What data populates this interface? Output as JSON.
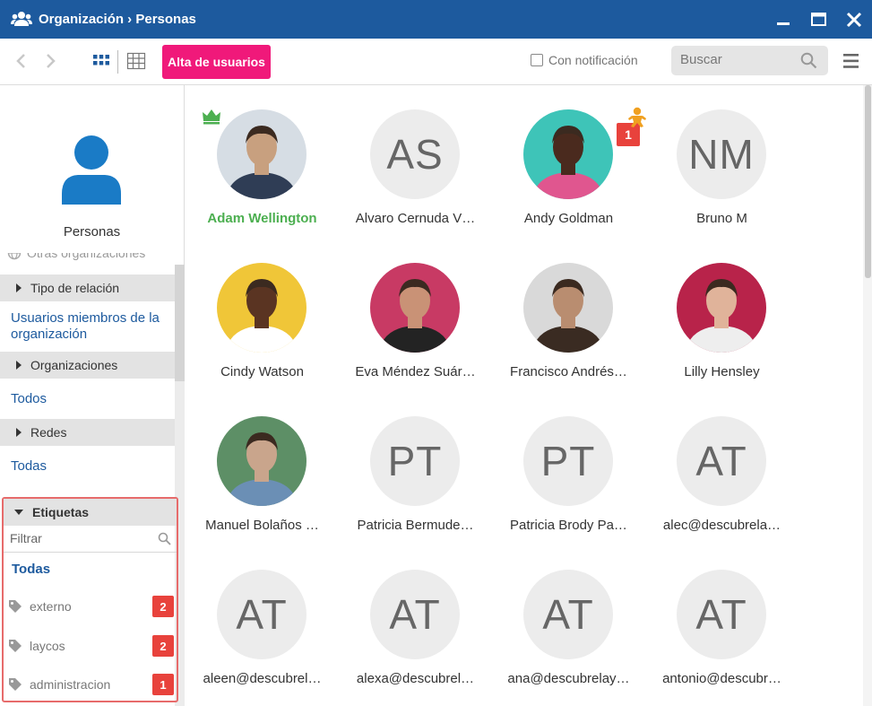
{
  "window": {
    "title": "Organización › Personas"
  },
  "toolbar": {
    "add_users_label": "Alta de usuarios",
    "notification_label": "Con notificación",
    "search_placeholder": "Buscar"
  },
  "sidebar": {
    "title": "Personas",
    "faded_item": "Otras organizaciones",
    "relation_type": "Tipo de relación",
    "members_link": "Usuarios miembros de la organización",
    "organizations": "Organizaciones",
    "organizations_value": "Todos",
    "networks": "Redes",
    "networks_value": "Todas",
    "tags": {
      "header": "Etiquetas",
      "filter_placeholder": "Filtrar",
      "all_label": "Todas",
      "items": [
        {
          "label": "externo",
          "count": "2"
        },
        {
          "label": "laycos",
          "count": "2"
        },
        {
          "label": "administracion",
          "count": "1"
        }
      ]
    }
  },
  "people": [
    {
      "name": "Adam Wellington",
      "initials": "",
      "photo": "man-suit-photo",
      "icon": "crown-icon"
    },
    {
      "name": "Alvaro Cernuda V…",
      "initials": "AS",
      "photo": "",
      "icon": ""
    },
    {
      "name": "Andy Goldman",
      "initials": "",
      "photo": "man-colorful-photo",
      "icon": "",
      "badge": "1"
    },
    {
      "name": "Bruno M",
      "initials": "NM",
      "photo": "",
      "icon": "baby-icon"
    },
    {
      "name": "Cindy Watson",
      "initials": "",
      "photo": "woman-curly-photo",
      "icon": ""
    },
    {
      "name": "Eva Méndez Suár…",
      "initials": "",
      "photo": "woman-pink-photo",
      "icon": ""
    },
    {
      "name": "Francisco Andrés…",
      "initials": "",
      "photo": "man-beard-photo",
      "icon": ""
    },
    {
      "name": "Lilly Hensley",
      "initials": "",
      "photo": "woman-glasses-photo",
      "icon": ""
    },
    {
      "name": "Manuel Bolaños …",
      "initials": "",
      "photo": "man-gray-photo",
      "icon": ""
    },
    {
      "name": "Patricia Bermude…",
      "initials": "PT",
      "photo": "",
      "icon": ""
    },
    {
      "name": "Patricia Brody Pa…",
      "initials": "PT",
      "photo": "",
      "icon": ""
    },
    {
      "name": "alec@descubrela…",
      "initials": "AT",
      "photo": "",
      "icon": ""
    },
    {
      "name": "aleen@descubrel…",
      "initials": "AT",
      "photo": "",
      "icon": ""
    },
    {
      "name": "alexa@descubrel…",
      "initials": "AT",
      "photo": "",
      "icon": ""
    },
    {
      "name": "ana@descubrelay…",
      "initials": "AT",
      "photo": "",
      "icon": ""
    },
    {
      "name": "antonio@descubr…",
      "initials": "AT",
      "photo": "",
      "icon": ""
    }
  ],
  "colors": {
    "title_bar": "#1d5a9e",
    "primary_button": "#f0197a",
    "highlight_name": "#4caf50",
    "badge": "#e8423c",
    "tags_outline": "#e76b6b"
  }
}
